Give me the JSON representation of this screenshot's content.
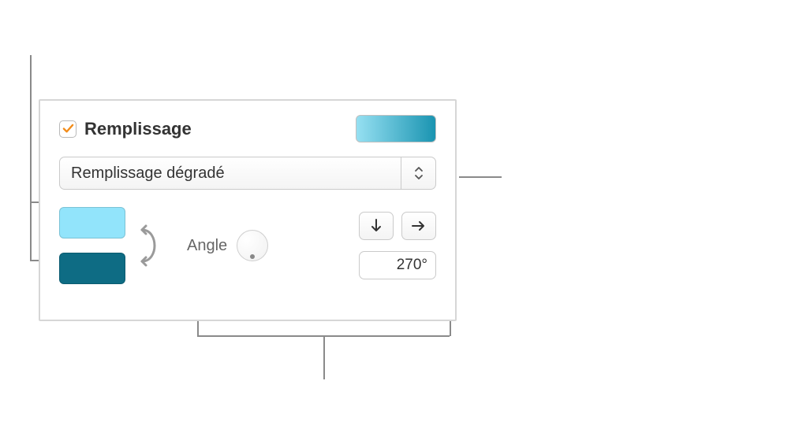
{
  "header": {
    "checkbox_label": "Remplissage",
    "checkbox_checked": true,
    "preview_gradient": {
      "from": "#96e0f2",
      "to": "#1a94b1"
    }
  },
  "fill_type": {
    "selected": "Remplissage dégradé"
  },
  "gradient": {
    "color1": "#92e4fb",
    "color2": "#0e6c84",
    "angle_label": "Angle",
    "angle_value": "270°",
    "angle_numeric": 270
  },
  "icons": {
    "checkmark": "checkmark-icon",
    "chevron_updown": "chevron-updown-icon",
    "swap": "swap-icon",
    "arrow_down": "arrow-down-icon",
    "arrow_right": "arrow-right-icon"
  },
  "colors": {
    "accent": "#f28c1a"
  }
}
